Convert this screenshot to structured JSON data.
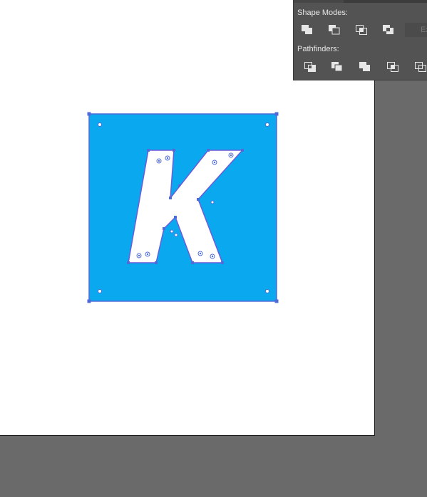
{
  "canvas": {
    "colors": {
      "pasteboard": "#6a6a6a",
      "artboard": "#ffffff",
      "square_fill": "#0aa9ef",
      "letter_fill": "#ffffff",
      "selection": "#4f6bd8"
    },
    "artwork": {
      "shape": "blue rounded square",
      "letter": "K"
    }
  },
  "pathfinder_panel": {
    "shape_modes_label": "Shape Modes:",
    "pathfinders_label": "Pathfinders:",
    "expand_label": "Ex",
    "shape_modes": [
      {
        "name": "unite",
        "icon": "unite-icon"
      },
      {
        "name": "minus-front",
        "icon": "minus-front-icon"
      },
      {
        "name": "intersect",
        "icon": "intersect-icon"
      },
      {
        "name": "exclude",
        "icon": "exclude-icon"
      }
    ],
    "pathfinders": [
      {
        "name": "divide",
        "icon": "divide-icon"
      },
      {
        "name": "trim",
        "icon": "trim-icon"
      },
      {
        "name": "merge",
        "icon": "merge-icon"
      },
      {
        "name": "crop",
        "icon": "crop-icon"
      },
      {
        "name": "outline",
        "icon": "outline-icon"
      }
    ]
  }
}
